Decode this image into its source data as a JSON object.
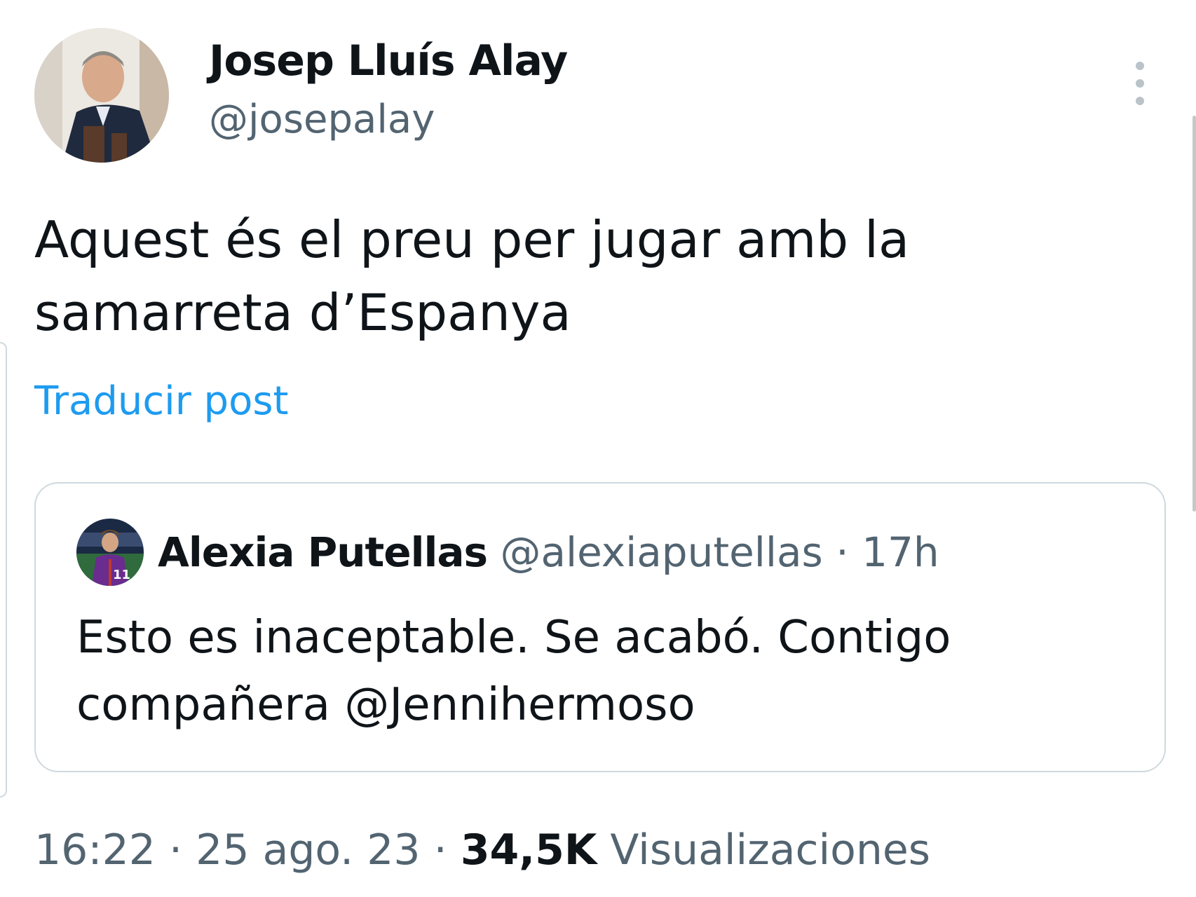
{
  "post": {
    "author": {
      "name": "Josep Lluís Alay",
      "handle": "@josepalay"
    },
    "text_lines": [
      "Aquest és el preu per jugar amb la",
      "samarreta d’Espanya"
    ],
    "translate_label": "Traducir post",
    "more_icon": "more-vertical-icon",
    "quoted": {
      "name": "Alexia Putellas",
      "handle": "@alexiaputellas",
      "separator": "·",
      "time": "17h",
      "text_lines": [
        "Esto es inaceptable. Se acabó. Contigo",
        "compañera @Jennihermoso"
      ]
    },
    "meta": {
      "time": "16:22",
      "separator": "·",
      "date": "25 ago. 23",
      "views_count": "34,5K",
      "views_label": "Visualizaciones"
    }
  },
  "colors": {
    "text_primary": "#0f1419",
    "text_secondary": "#536471",
    "link": "#1d9bf0",
    "border": "#cfd9de"
  }
}
